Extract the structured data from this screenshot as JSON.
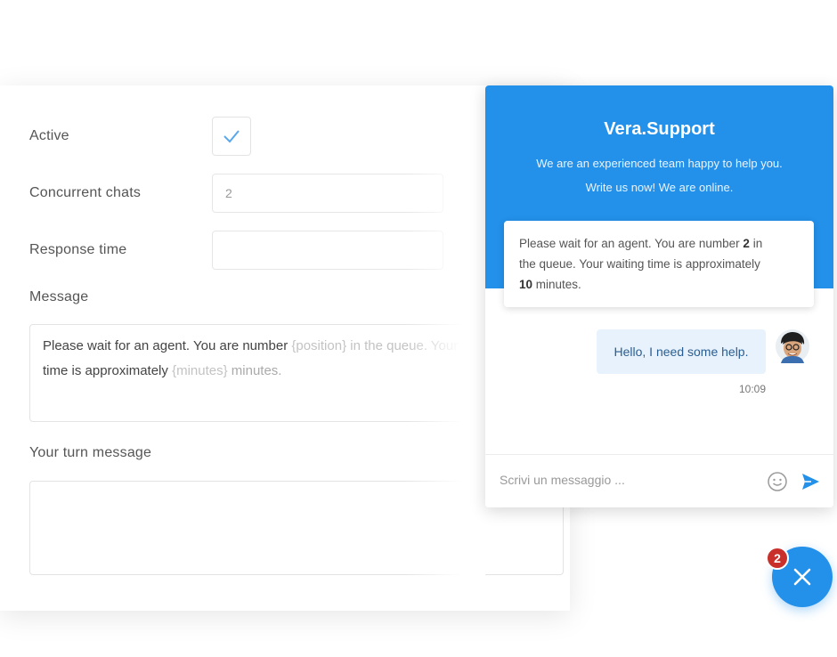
{
  "settings": {
    "active_label": "Active",
    "concurrent_label": "Concurrent chats",
    "concurrent_value": "2",
    "response_label": "Response time",
    "response_value": "",
    "message_label": "Message",
    "message_text": {
      "part1": "Please wait for an agent. You are number ",
      "var1": "{position}",
      "part2": " in the queue. Your waiting",
      "part3": "time is approximately ",
      "var2": "{minutes}",
      "part4": " minutes."
    },
    "turn_label": "Your turn message",
    "turn_value": ""
  },
  "chat": {
    "title": "Vera.Support",
    "subtitle_line1": "We are an experienced team happy to help you.",
    "subtitle_line2": "Write us now! We are online.",
    "notice": {
      "part1": "Please wait for an agent. You are number ",
      "number": "2",
      "part2": " in",
      "part3": "the queue. Your waiting time is approximately",
      "minutes": "10",
      "part4": " minutes."
    },
    "message": "Hello, I need some help.",
    "message_time": "10:09",
    "composer_placeholder": "Scrivi un messaggio ...",
    "badge_count": "2",
    "accent": "#2390e9",
    "badge_color": "#c9302c",
    "icons": [
      "checkmark-icon",
      "smiley-icon",
      "send-icon",
      "close-icon"
    ]
  }
}
